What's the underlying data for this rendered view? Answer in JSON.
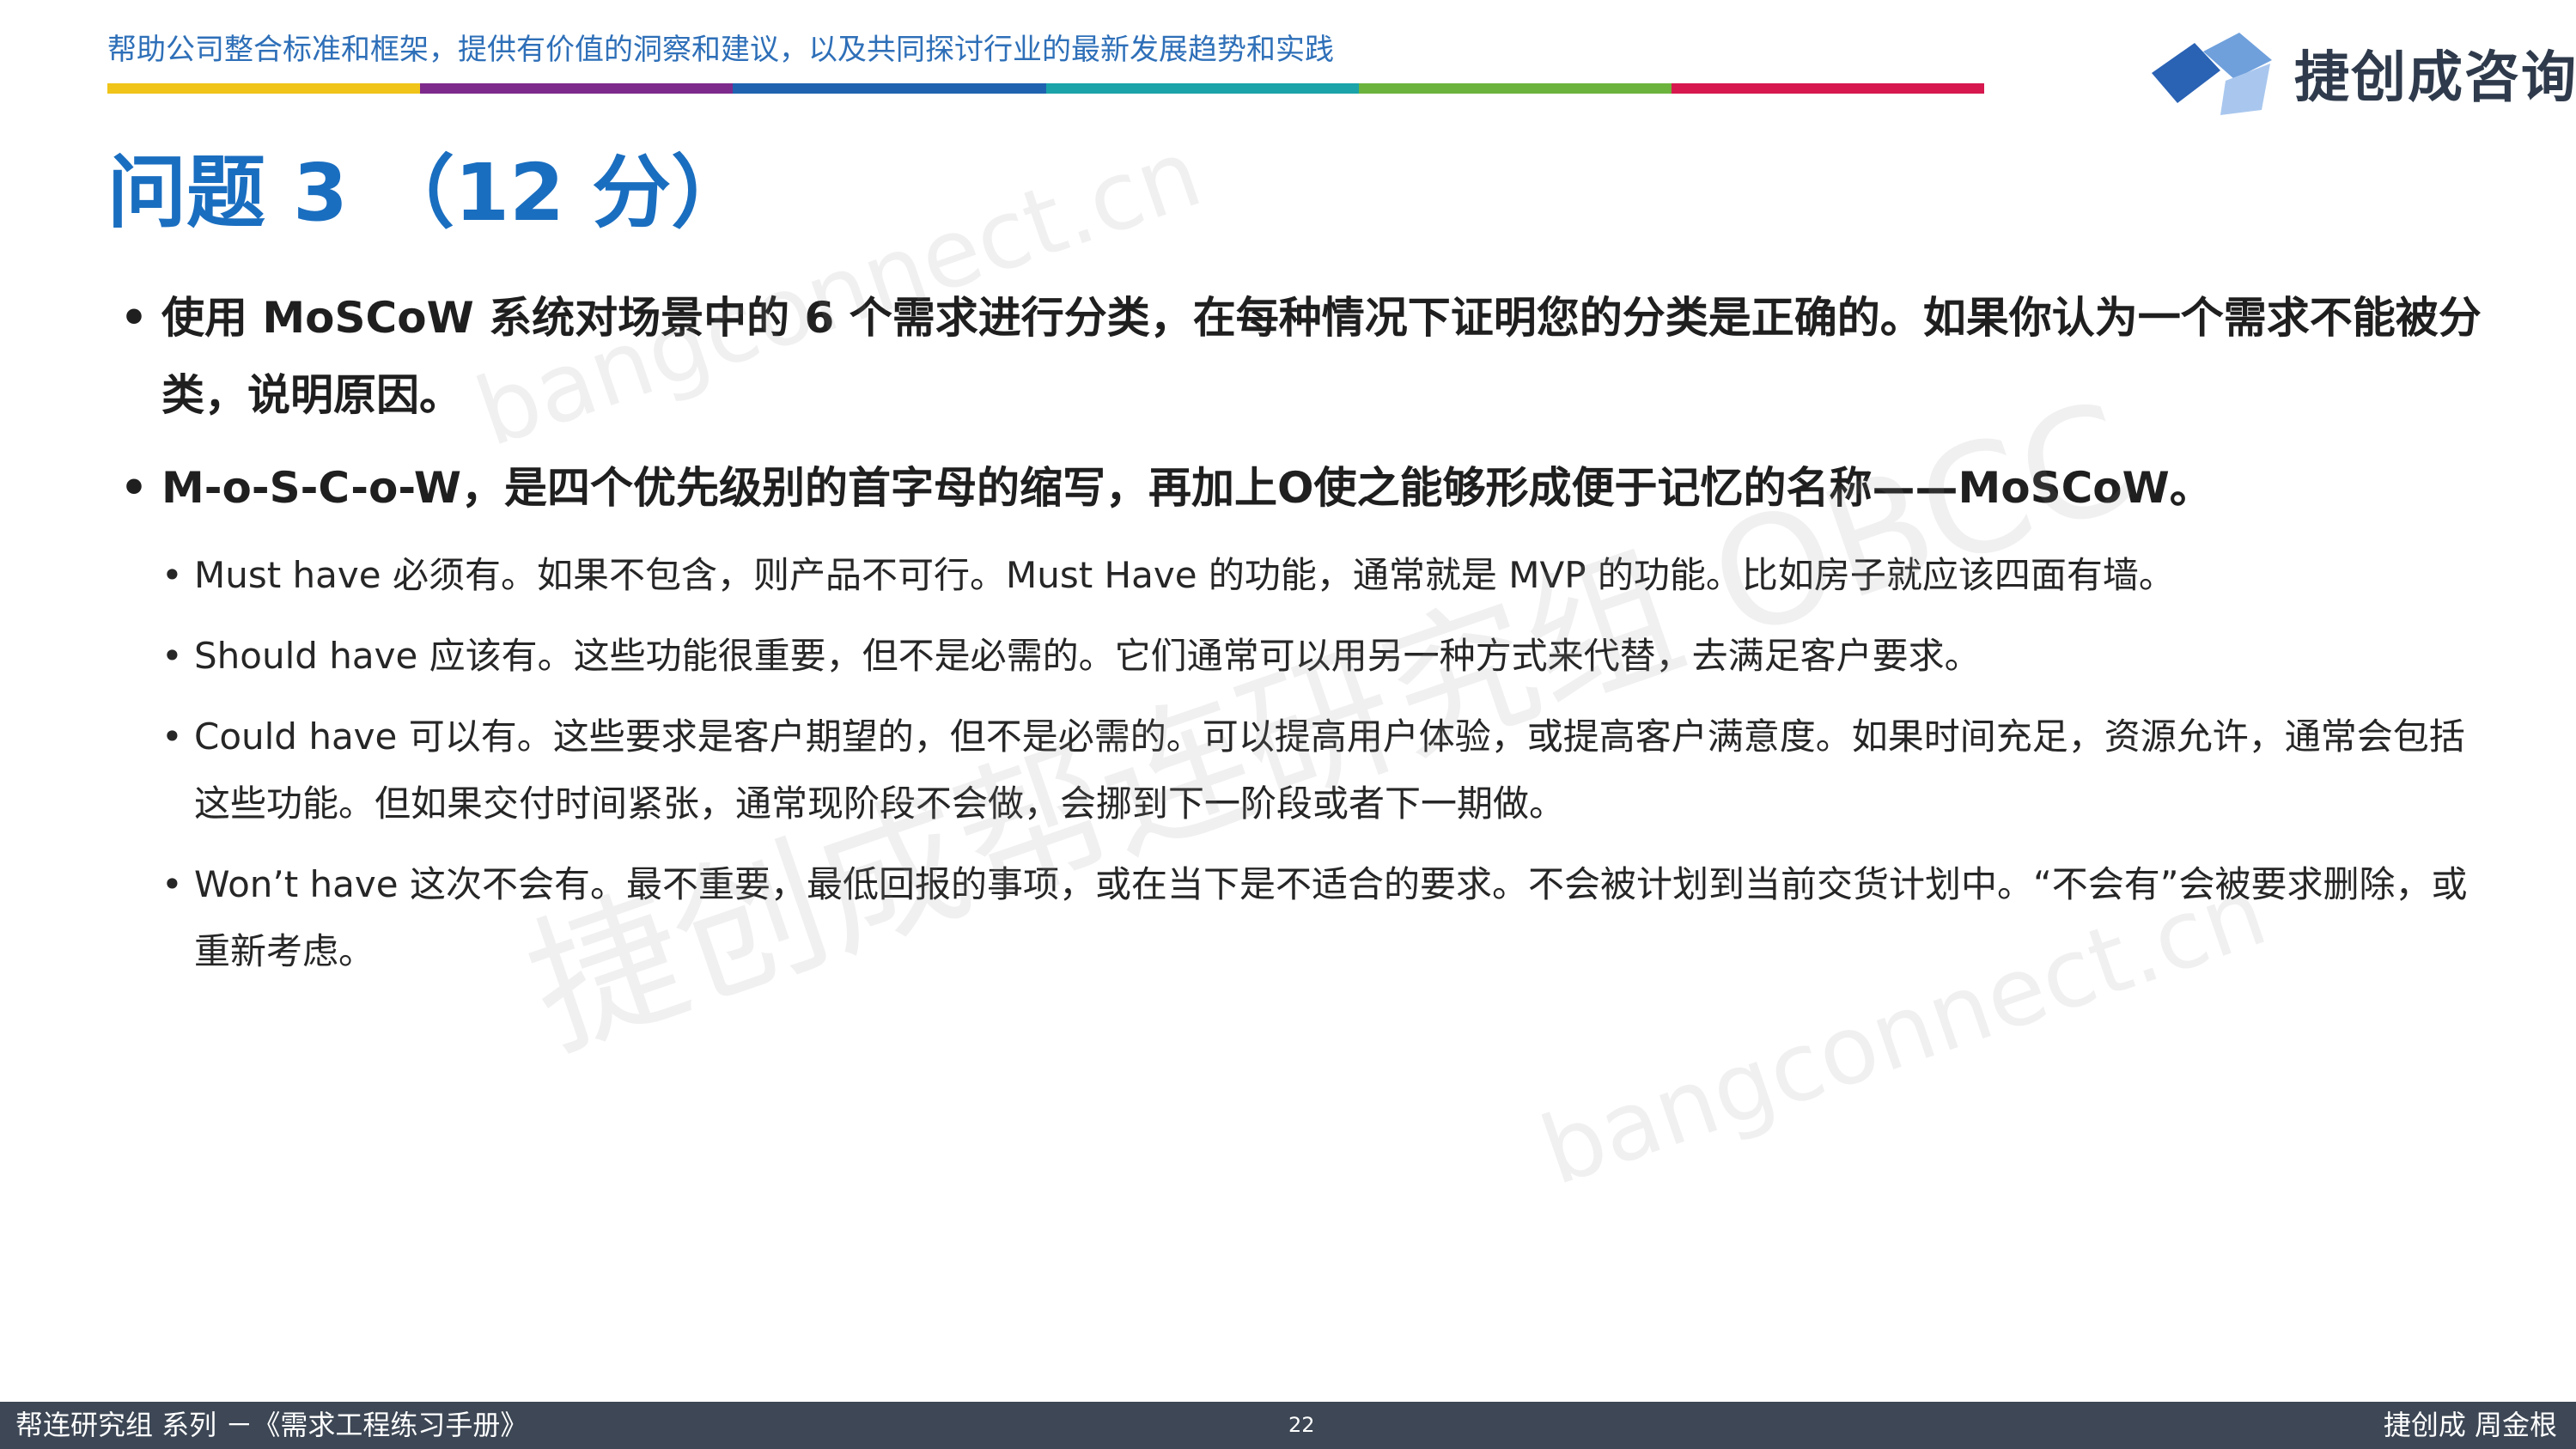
{
  "header": {
    "tagline": "帮助公司整合标准和框架，提供有价值的洞察和建议，以及共同探讨行业的最新发展趋势和实践",
    "color_bar": [
      "#f0c419",
      "#7d2a8c",
      "#1f63b0",
      "#1aa3a8",
      "#6cb33e",
      "#d6184f"
    ],
    "logo": {
      "icon": "cube-logo-icon",
      "text": "捷创成咨询",
      "colors": [
        "#2a62b4",
        "#6fa0dc",
        "#a9c7ee"
      ]
    }
  },
  "title": "问题 3 （12 分）",
  "bullets": [
    {
      "text": "使用 MoSCoW 系统对场景中的 6 个需求进行分类，在每种情况下证明您的分类是正确的。如果你认为一个需求不能被分类，说明原因。"
    },
    {
      "text": "M-o-S-C-o-W，是四个优先级别的首字母的缩写，再加上O使之能够形成便于记忆的名称——MoSCoW。",
      "sub": [
        "Must have 必须有。如果不包含，则产品不可行。Must Have 的功能，通常就是 MVP 的功能。比如房子就应该四面有墙。",
        "Should have 应该有。这些功能很重要，但不是必需的。它们通常可以用另一种方式来代替，去满足客户要求。",
        "Could have 可以有。这些要求是客户期望的，但不是必需的。可以提高用户体验，或提高客户满意度。如果时间充足，资源允许，通常会包括这些功能。但如果交付时间紧张，通常现阶段不会做，会挪到下一阶段或者下一期做。",
        "Won’t have 这次不会有。最不重要，最低回报的事项，或在当下是不适合的要求。不会被计划到当前交货计划中。“不会有”会被要求删除，或重新考虑。"
      ]
    }
  ],
  "bullet_char": "•",
  "watermarks": [
    "bangconnect.cn",
    "捷创成帮连研究组 OBCC",
    "bangconnect.cn"
  ],
  "footer": {
    "left": "帮连研究组 系列 －《需求工程练习手册》",
    "page": "22",
    "right": "捷创成 周金根",
    "background": "#3d4755"
  }
}
